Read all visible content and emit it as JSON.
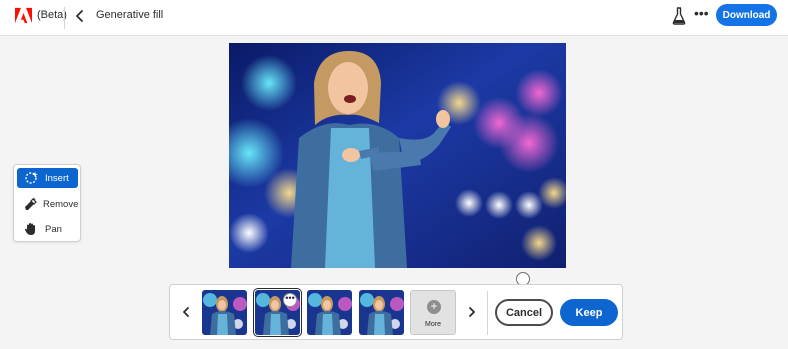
{
  "header": {
    "app_badge": "(Beta)",
    "title": "Generative fill",
    "download_label": "Download",
    "more_label": "•••",
    "brand_color": "#fa0f00",
    "accent_color": "#1473e6"
  },
  "toolbar": {
    "tools": [
      {
        "label": "Insert",
        "icon": "insert-lasso-icon",
        "active": true
      },
      {
        "label": "Remove",
        "icon": "eraser-icon",
        "active": false
      },
      {
        "label": "Pan",
        "icon": "hand-icon",
        "active": false
      }
    ]
  },
  "canvas": {
    "description_icon": "photo-woman-denim-jacket-bokeh"
  },
  "variations": {
    "count": 4,
    "selected_index": 1,
    "thumb_more_label": "•••",
    "more_tile_label": "More",
    "more_tile_icon": "plus-icon"
  },
  "actions": {
    "cancel_label": "Cancel",
    "keep_label": "Keep"
  }
}
